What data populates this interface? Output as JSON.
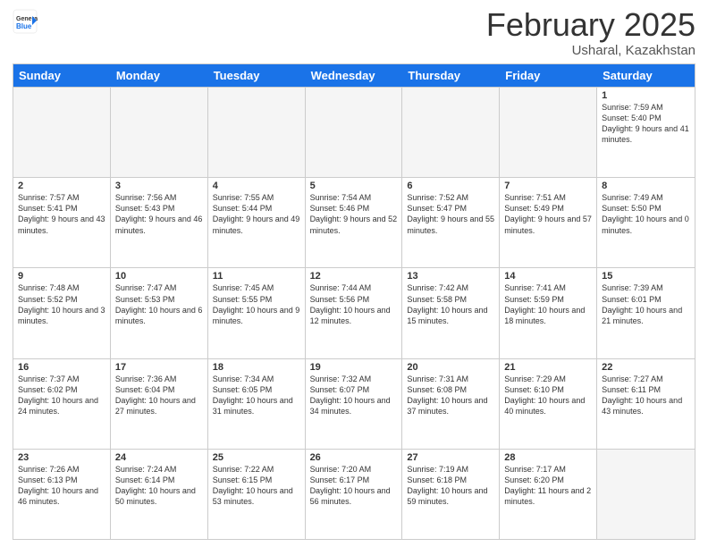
{
  "header": {
    "logo_general": "General",
    "logo_blue": "Blue",
    "month_title": "February 2025",
    "location": "Usharal, Kazakhstan"
  },
  "weekdays": [
    "Sunday",
    "Monday",
    "Tuesday",
    "Wednesday",
    "Thursday",
    "Friday",
    "Saturday"
  ],
  "rows": [
    [
      {
        "day": "",
        "info": ""
      },
      {
        "day": "",
        "info": ""
      },
      {
        "day": "",
        "info": ""
      },
      {
        "day": "",
        "info": ""
      },
      {
        "day": "",
        "info": ""
      },
      {
        "day": "",
        "info": ""
      },
      {
        "day": "1",
        "info": "Sunrise: 7:59 AM\nSunset: 5:40 PM\nDaylight: 9 hours and 41 minutes."
      }
    ],
    [
      {
        "day": "2",
        "info": "Sunrise: 7:57 AM\nSunset: 5:41 PM\nDaylight: 9 hours and 43 minutes."
      },
      {
        "day": "3",
        "info": "Sunrise: 7:56 AM\nSunset: 5:43 PM\nDaylight: 9 hours and 46 minutes."
      },
      {
        "day": "4",
        "info": "Sunrise: 7:55 AM\nSunset: 5:44 PM\nDaylight: 9 hours and 49 minutes."
      },
      {
        "day": "5",
        "info": "Sunrise: 7:54 AM\nSunset: 5:46 PM\nDaylight: 9 hours and 52 minutes."
      },
      {
        "day": "6",
        "info": "Sunrise: 7:52 AM\nSunset: 5:47 PM\nDaylight: 9 hours and 55 minutes."
      },
      {
        "day": "7",
        "info": "Sunrise: 7:51 AM\nSunset: 5:49 PM\nDaylight: 9 hours and 57 minutes."
      },
      {
        "day": "8",
        "info": "Sunrise: 7:49 AM\nSunset: 5:50 PM\nDaylight: 10 hours and 0 minutes."
      }
    ],
    [
      {
        "day": "9",
        "info": "Sunrise: 7:48 AM\nSunset: 5:52 PM\nDaylight: 10 hours and 3 minutes."
      },
      {
        "day": "10",
        "info": "Sunrise: 7:47 AM\nSunset: 5:53 PM\nDaylight: 10 hours and 6 minutes."
      },
      {
        "day": "11",
        "info": "Sunrise: 7:45 AM\nSunset: 5:55 PM\nDaylight: 10 hours and 9 minutes."
      },
      {
        "day": "12",
        "info": "Sunrise: 7:44 AM\nSunset: 5:56 PM\nDaylight: 10 hours and 12 minutes."
      },
      {
        "day": "13",
        "info": "Sunrise: 7:42 AM\nSunset: 5:58 PM\nDaylight: 10 hours and 15 minutes."
      },
      {
        "day": "14",
        "info": "Sunrise: 7:41 AM\nSunset: 5:59 PM\nDaylight: 10 hours and 18 minutes."
      },
      {
        "day": "15",
        "info": "Sunrise: 7:39 AM\nSunset: 6:01 PM\nDaylight: 10 hours and 21 minutes."
      }
    ],
    [
      {
        "day": "16",
        "info": "Sunrise: 7:37 AM\nSunset: 6:02 PM\nDaylight: 10 hours and 24 minutes."
      },
      {
        "day": "17",
        "info": "Sunrise: 7:36 AM\nSunset: 6:04 PM\nDaylight: 10 hours and 27 minutes."
      },
      {
        "day": "18",
        "info": "Sunrise: 7:34 AM\nSunset: 6:05 PM\nDaylight: 10 hours and 31 minutes."
      },
      {
        "day": "19",
        "info": "Sunrise: 7:32 AM\nSunset: 6:07 PM\nDaylight: 10 hours and 34 minutes."
      },
      {
        "day": "20",
        "info": "Sunrise: 7:31 AM\nSunset: 6:08 PM\nDaylight: 10 hours and 37 minutes."
      },
      {
        "day": "21",
        "info": "Sunrise: 7:29 AM\nSunset: 6:10 PM\nDaylight: 10 hours and 40 minutes."
      },
      {
        "day": "22",
        "info": "Sunrise: 7:27 AM\nSunset: 6:11 PM\nDaylight: 10 hours and 43 minutes."
      }
    ],
    [
      {
        "day": "23",
        "info": "Sunrise: 7:26 AM\nSunset: 6:13 PM\nDaylight: 10 hours and 46 minutes."
      },
      {
        "day": "24",
        "info": "Sunrise: 7:24 AM\nSunset: 6:14 PM\nDaylight: 10 hours and 50 minutes."
      },
      {
        "day": "25",
        "info": "Sunrise: 7:22 AM\nSunset: 6:15 PM\nDaylight: 10 hours and 53 minutes."
      },
      {
        "day": "26",
        "info": "Sunrise: 7:20 AM\nSunset: 6:17 PM\nDaylight: 10 hours and 56 minutes."
      },
      {
        "day": "27",
        "info": "Sunrise: 7:19 AM\nSunset: 6:18 PM\nDaylight: 10 hours and 59 minutes."
      },
      {
        "day": "28",
        "info": "Sunrise: 7:17 AM\nSunset: 6:20 PM\nDaylight: 11 hours and 2 minutes."
      },
      {
        "day": "",
        "info": ""
      }
    ]
  ]
}
